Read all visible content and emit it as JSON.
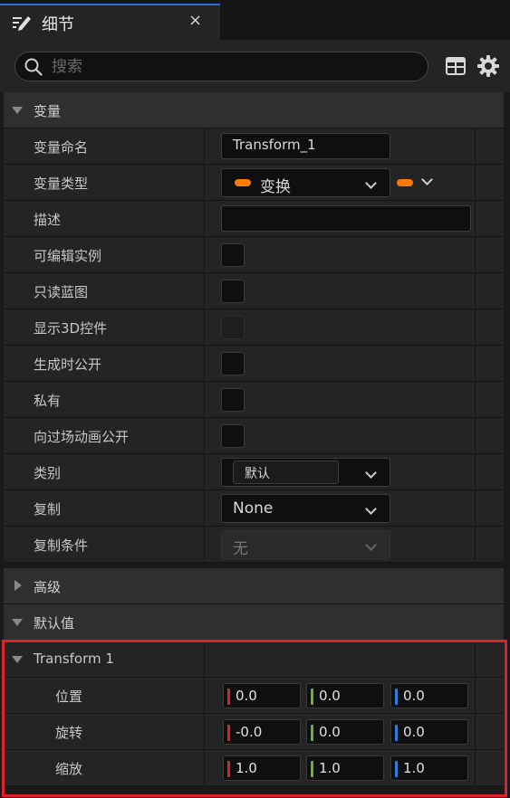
{
  "tab": {
    "title": "细节",
    "close": "×",
    "icon": "edit-details-icon"
  },
  "search": {
    "placeholder": "搜索",
    "value": ""
  },
  "toolbar": {
    "table_icon": "table-view-icon",
    "settings_icon": "gear-icon"
  },
  "sections": {
    "variable": "变量",
    "advanced": "高级",
    "default_value": "默认值"
  },
  "variable_rows": {
    "name_label": "变量命名",
    "name_value": "Transform_1",
    "type_label": "变量类型",
    "type_value": "变换",
    "description_label": "描述",
    "description_value": "",
    "instance_editable_label": "可编辑实例",
    "blueprint_readonly_label": "只读蓝图",
    "show_3d_widget_label": "显示3D控件",
    "expose_on_spawn_label": "生成时公开",
    "private_label": "私有",
    "expose_cinematics_label": "向过场动画公开",
    "category_label": "类别",
    "category_value": "默认",
    "replication_label": "复制",
    "replication_value": "None",
    "replication_condition_label": "复制条件",
    "replication_condition_value": "无"
  },
  "transform": {
    "name": "Transform 1",
    "location_label": "位置",
    "location": [
      "0.0",
      "0.0",
      "0.0"
    ],
    "rotation_label": "旋转",
    "rotation": [
      "-0.0",
      "0.0",
      "0.0"
    ],
    "scale_label": "缩放",
    "scale": [
      "1.0",
      "1.0",
      "1.0"
    ]
  },
  "colors": {
    "accent_blue": "#2a6bd6",
    "type_pill": "#ff7a00",
    "axis_x": "#d3272e",
    "axis_y": "#6cb22a",
    "axis_z": "#2f7fe0",
    "highlight": "#e0202a"
  }
}
